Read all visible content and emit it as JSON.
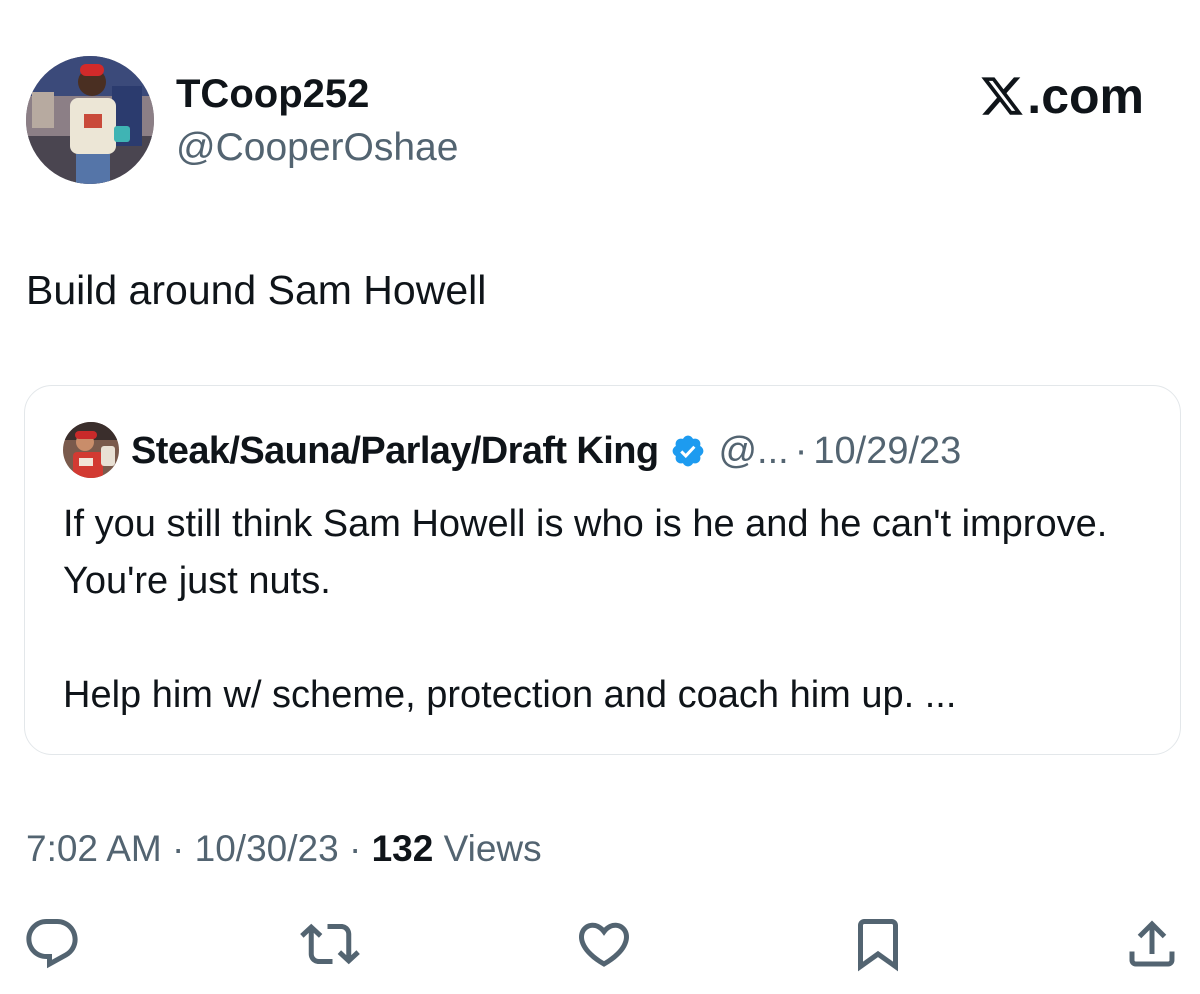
{
  "author": {
    "display_name": "TCoop252",
    "handle": "@CooperOshae"
  },
  "brand": {
    "label": ".com"
  },
  "tweet": {
    "text": "Build around Sam Howell",
    "time": "7:02 AM",
    "date": "10/30/23",
    "views_count": "132",
    "views_label": "Views",
    "separator": "·"
  },
  "quote": {
    "display_name": "Steak/Sauna/Parlay/Draft King",
    "handle": "@...",
    "separator": "·",
    "date": "10/29/23",
    "text": "If you still think Sam Howell is who is he and he can't improve.  You're just nuts.\n\nHelp him w/ scheme, protection and coach him up.  ...",
    "verified": true
  },
  "actions": [
    {
      "name": "reply-icon"
    },
    {
      "name": "retweet-icon"
    },
    {
      "name": "like-icon"
    },
    {
      "name": "bookmark-icon"
    },
    {
      "name": "share-icon"
    }
  ],
  "colors": {
    "text": "#0f1419",
    "secondary": "#536471",
    "verified": "#1d9bf0",
    "border": "#e3e7ea"
  }
}
